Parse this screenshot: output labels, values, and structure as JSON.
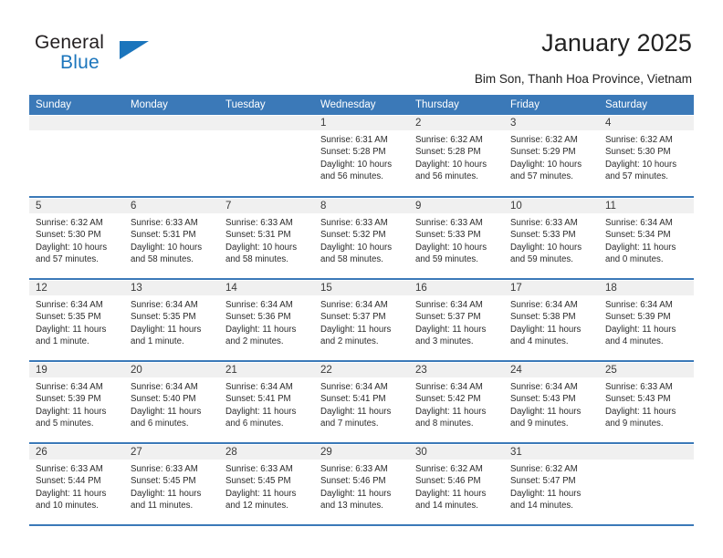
{
  "brand": {
    "name_part1": "General",
    "name_part2": "Blue",
    "triangle_icon": "triangle-icon",
    "accent_color": "#1B75BC"
  },
  "header": {
    "title": "January 2025",
    "location": "Bim Son, Thanh Hoa Province, Vietnam"
  },
  "theme": {
    "header_blue": "#3B79B8",
    "daynum_gray": "#F0F0F0",
    "text": "#2B2B2B"
  },
  "weekdays": [
    "Sunday",
    "Monday",
    "Tuesday",
    "Wednesday",
    "Thursday",
    "Friday",
    "Saturday"
  ],
  "weeks": [
    [
      {
        "day": "",
        "empty": true
      },
      {
        "day": "",
        "empty": true
      },
      {
        "day": "",
        "empty": true
      },
      {
        "day": "1",
        "sunrise": "Sunrise: 6:31 AM",
        "sunset": "Sunset: 5:28 PM",
        "daylight_line1": "Daylight: 10 hours",
        "daylight_line2": "and 56 minutes."
      },
      {
        "day": "2",
        "sunrise": "Sunrise: 6:32 AM",
        "sunset": "Sunset: 5:28 PM",
        "daylight_line1": "Daylight: 10 hours",
        "daylight_line2": "and 56 minutes."
      },
      {
        "day": "3",
        "sunrise": "Sunrise: 6:32 AM",
        "sunset": "Sunset: 5:29 PM",
        "daylight_line1": "Daylight: 10 hours",
        "daylight_line2": "and 57 minutes."
      },
      {
        "day": "4",
        "sunrise": "Sunrise: 6:32 AM",
        "sunset": "Sunset: 5:30 PM",
        "daylight_line1": "Daylight: 10 hours",
        "daylight_line2": "and 57 minutes."
      }
    ],
    [
      {
        "day": "5",
        "sunrise": "Sunrise: 6:32 AM",
        "sunset": "Sunset: 5:30 PM",
        "daylight_line1": "Daylight: 10 hours",
        "daylight_line2": "and 57 minutes."
      },
      {
        "day": "6",
        "sunrise": "Sunrise: 6:33 AM",
        "sunset": "Sunset: 5:31 PM",
        "daylight_line1": "Daylight: 10 hours",
        "daylight_line2": "and 58 minutes."
      },
      {
        "day": "7",
        "sunrise": "Sunrise: 6:33 AM",
        "sunset": "Sunset: 5:31 PM",
        "daylight_line1": "Daylight: 10 hours",
        "daylight_line2": "and 58 minutes."
      },
      {
        "day": "8",
        "sunrise": "Sunrise: 6:33 AM",
        "sunset": "Sunset: 5:32 PM",
        "daylight_line1": "Daylight: 10 hours",
        "daylight_line2": "and 58 minutes."
      },
      {
        "day": "9",
        "sunrise": "Sunrise: 6:33 AM",
        "sunset": "Sunset: 5:33 PM",
        "daylight_line1": "Daylight: 10 hours",
        "daylight_line2": "and 59 minutes."
      },
      {
        "day": "10",
        "sunrise": "Sunrise: 6:33 AM",
        "sunset": "Sunset: 5:33 PM",
        "daylight_line1": "Daylight: 10 hours",
        "daylight_line2": "and 59 minutes."
      },
      {
        "day": "11",
        "sunrise": "Sunrise: 6:34 AM",
        "sunset": "Sunset: 5:34 PM",
        "daylight_line1": "Daylight: 11 hours",
        "daylight_line2": "and 0 minutes."
      }
    ],
    [
      {
        "day": "12",
        "sunrise": "Sunrise: 6:34 AM",
        "sunset": "Sunset: 5:35 PM",
        "daylight_line1": "Daylight: 11 hours",
        "daylight_line2": "and 1 minute."
      },
      {
        "day": "13",
        "sunrise": "Sunrise: 6:34 AM",
        "sunset": "Sunset: 5:35 PM",
        "daylight_line1": "Daylight: 11 hours",
        "daylight_line2": "and 1 minute."
      },
      {
        "day": "14",
        "sunrise": "Sunrise: 6:34 AM",
        "sunset": "Sunset: 5:36 PM",
        "daylight_line1": "Daylight: 11 hours",
        "daylight_line2": "and 2 minutes."
      },
      {
        "day": "15",
        "sunrise": "Sunrise: 6:34 AM",
        "sunset": "Sunset: 5:37 PM",
        "daylight_line1": "Daylight: 11 hours",
        "daylight_line2": "and 2 minutes."
      },
      {
        "day": "16",
        "sunrise": "Sunrise: 6:34 AM",
        "sunset": "Sunset: 5:37 PM",
        "daylight_line1": "Daylight: 11 hours",
        "daylight_line2": "and 3 minutes."
      },
      {
        "day": "17",
        "sunrise": "Sunrise: 6:34 AM",
        "sunset": "Sunset: 5:38 PM",
        "daylight_line1": "Daylight: 11 hours",
        "daylight_line2": "and 4 minutes."
      },
      {
        "day": "18",
        "sunrise": "Sunrise: 6:34 AM",
        "sunset": "Sunset: 5:39 PM",
        "daylight_line1": "Daylight: 11 hours",
        "daylight_line2": "and 4 minutes."
      }
    ],
    [
      {
        "day": "19",
        "sunrise": "Sunrise: 6:34 AM",
        "sunset": "Sunset: 5:39 PM",
        "daylight_line1": "Daylight: 11 hours",
        "daylight_line2": "and 5 minutes."
      },
      {
        "day": "20",
        "sunrise": "Sunrise: 6:34 AM",
        "sunset": "Sunset: 5:40 PM",
        "daylight_line1": "Daylight: 11 hours",
        "daylight_line2": "and 6 minutes."
      },
      {
        "day": "21",
        "sunrise": "Sunrise: 6:34 AM",
        "sunset": "Sunset: 5:41 PM",
        "daylight_line1": "Daylight: 11 hours",
        "daylight_line2": "and 6 minutes."
      },
      {
        "day": "22",
        "sunrise": "Sunrise: 6:34 AM",
        "sunset": "Sunset: 5:41 PM",
        "daylight_line1": "Daylight: 11 hours",
        "daylight_line2": "and 7 minutes."
      },
      {
        "day": "23",
        "sunrise": "Sunrise: 6:34 AM",
        "sunset": "Sunset: 5:42 PM",
        "daylight_line1": "Daylight: 11 hours",
        "daylight_line2": "and 8 minutes."
      },
      {
        "day": "24",
        "sunrise": "Sunrise: 6:34 AM",
        "sunset": "Sunset: 5:43 PM",
        "daylight_line1": "Daylight: 11 hours",
        "daylight_line2": "and 9 minutes."
      },
      {
        "day": "25",
        "sunrise": "Sunrise: 6:33 AM",
        "sunset": "Sunset: 5:43 PM",
        "daylight_line1": "Daylight: 11 hours",
        "daylight_line2": "and 9 minutes."
      }
    ],
    [
      {
        "day": "26",
        "sunrise": "Sunrise: 6:33 AM",
        "sunset": "Sunset: 5:44 PM",
        "daylight_line1": "Daylight: 11 hours",
        "daylight_line2": "and 10 minutes."
      },
      {
        "day": "27",
        "sunrise": "Sunrise: 6:33 AM",
        "sunset": "Sunset: 5:45 PM",
        "daylight_line1": "Daylight: 11 hours",
        "daylight_line2": "and 11 minutes."
      },
      {
        "day": "28",
        "sunrise": "Sunrise: 6:33 AM",
        "sunset": "Sunset: 5:45 PM",
        "daylight_line1": "Daylight: 11 hours",
        "daylight_line2": "and 12 minutes."
      },
      {
        "day": "29",
        "sunrise": "Sunrise: 6:33 AM",
        "sunset": "Sunset: 5:46 PM",
        "daylight_line1": "Daylight: 11 hours",
        "daylight_line2": "and 13 minutes."
      },
      {
        "day": "30",
        "sunrise": "Sunrise: 6:32 AM",
        "sunset": "Sunset: 5:46 PM",
        "daylight_line1": "Daylight: 11 hours",
        "daylight_line2": "and 14 minutes."
      },
      {
        "day": "31",
        "sunrise": "Sunrise: 6:32 AM",
        "sunset": "Sunset: 5:47 PM",
        "daylight_line1": "Daylight: 11 hours",
        "daylight_line2": "and 14 minutes."
      },
      {
        "day": "",
        "empty": true
      }
    ]
  ]
}
